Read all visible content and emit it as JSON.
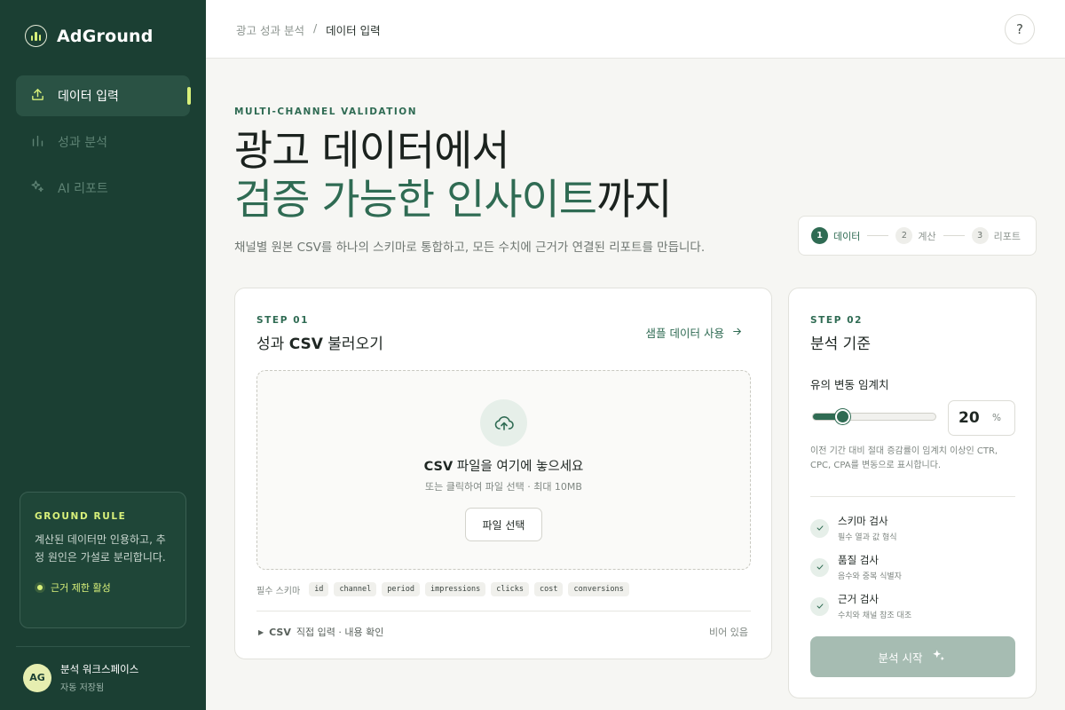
{
  "brand": {
    "name": "AdGround"
  },
  "sidebar": {
    "items": [
      {
        "label": "데이터 입력",
        "icon": "upload-icon",
        "active": true
      },
      {
        "label": "성과 분석",
        "icon": "bar-chart-icon",
        "active": false
      },
      {
        "label": "AI 리포트",
        "icon": "sparkles-icon",
        "active": false
      }
    ],
    "rule": {
      "title": "GROUND RULE",
      "text": "계산된 데이터만 인용하고, 추정 원인은 가설로 분리합니다.",
      "badge": "근거 제한 활성"
    },
    "workspace": {
      "avatar": "AG",
      "name": "분석 워크스페이스",
      "status": "자동 저장됨"
    }
  },
  "header": {
    "breadcrumb": [
      "광고 성과 분석",
      "/",
      "데이터 입력"
    ],
    "help": "?"
  },
  "hero": {
    "eyebrow": "MULTI-CHANNEL VALIDATION",
    "title_line1": "광고 데이터에서",
    "title_line2_green": "검증 가능한 인사이트",
    "title_line2_rest": "까지",
    "description": "채널별 원본 CSV를 하나의 스키마로 통합하고, 모든 수치에 근거가 연결된 리포트를 만듭니다."
  },
  "stepper": [
    {
      "num": "1",
      "label": "데이터",
      "active": true
    },
    {
      "num": "2",
      "label": "계산",
      "active": false
    },
    {
      "num": "3",
      "label": "리포트",
      "active": false
    }
  ],
  "upload": {
    "step_tag": "STEP 01",
    "title_pre": "성과 ",
    "title_bold": "CSV",
    "title_post": " 불러오기",
    "sample_link": "샘플 데이터 사용",
    "drop_title_bold": "CSV",
    "drop_title_rest": " 파일을 여기에 놓으세요",
    "drop_sub": "또는 클릭하여 파일 선택 · 최대 10MB",
    "file_button": "파일 선택",
    "schema_label": "필수 스키마",
    "schema": [
      "id",
      "channel",
      "period",
      "impressions",
      "clicks",
      "cost",
      "conversions"
    ],
    "csv_toggle_bold": "CSV",
    "csv_toggle_rest": "직접 입력 · 내용 확인",
    "empty_state": "비어 있음"
  },
  "analysis": {
    "step_tag": "STEP 02",
    "title": "분석 기준",
    "threshold_label": "유의 변동 임계치",
    "threshold_value": "20",
    "threshold_unit": "%",
    "slider_fraction": 0.24,
    "threshold_desc": "이전 기간 대비 절대 증감률이 임계치 이상인 CTR, CPC, CPA를 변동으로 표시합니다.",
    "checks": [
      {
        "title": "스키마 검사",
        "sub": "필수 열과 값 형식"
      },
      {
        "title": "품질 검사",
        "sub": "음수와 중복 식별자"
      },
      {
        "title": "근거 검사",
        "sub": "수치와 채널 참조 대조"
      }
    ],
    "start_button": "분석 시작"
  },
  "colors": {
    "sidebar_bg": "#1b3f33",
    "accent_green": "#2f6b53",
    "accent_lime": "#d8f07a",
    "start_button_disabled": "#a6bcb2"
  }
}
